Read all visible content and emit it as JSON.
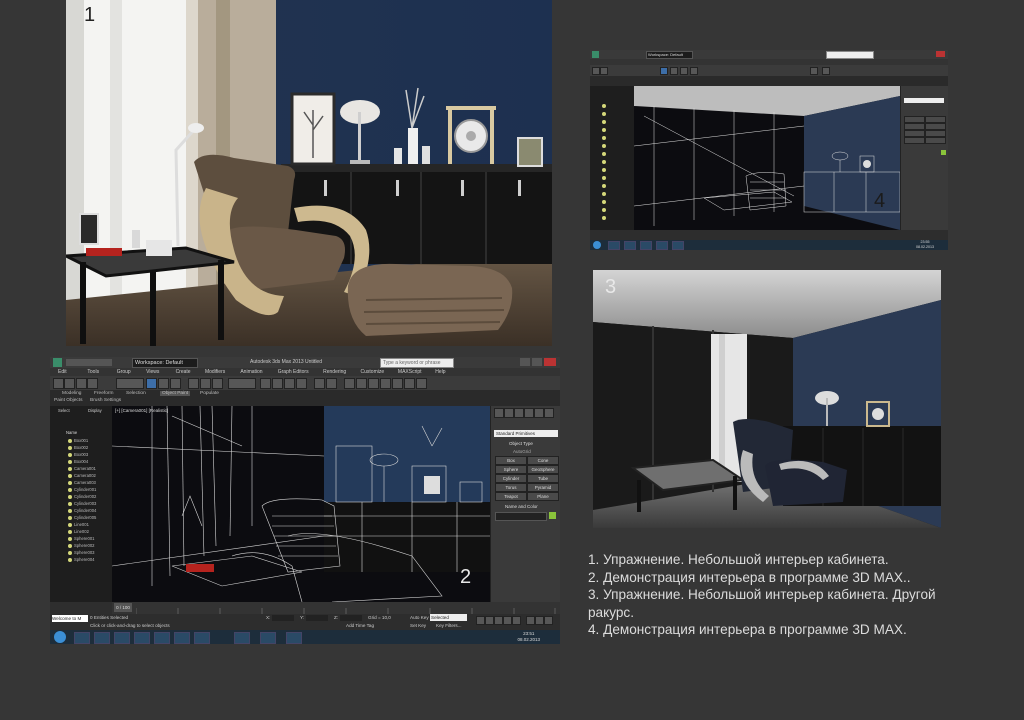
{
  "panels": [
    {
      "number": "1"
    },
    {
      "number": "2"
    },
    {
      "number": "3"
    },
    {
      "number": "4"
    }
  ],
  "max_ui_large": {
    "workspace": "Workspace: Default",
    "title": "Autodesk 3ds Max 2013 Untitled",
    "search_placeholder": "Type a keyword or phrase",
    "menu": [
      "Edit",
      "Tools",
      "Group",
      "Views",
      "Create",
      "Modifiers",
      "Animation",
      "Graph Editors",
      "Rendering",
      "Customize",
      "MAXScript",
      "Help"
    ],
    "ribbon_tabs": [
      "Modeling",
      "Freeform",
      "Selection",
      "Object Paint",
      "Populate"
    ],
    "ribbon_sub": [
      "Paint Objects",
      "Brush Settings"
    ],
    "scene_tabs": [
      "Select",
      "Display"
    ],
    "scene_header": "Name",
    "scene_items": [
      "Box001",
      "Box002",
      "Box003",
      "Box004",
      "Camera001",
      "Camera002",
      "Camera003",
      "Cylinder001",
      "Cylinder002",
      "Cylinder003",
      "Cylinder004",
      "Cylinder005",
      "Line001",
      "Line002",
      "Sphere001",
      "Sphere002",
      "Sphere003",
      "Sphere004"
    ],
    "viewport_label": "[+] [Camera001] [Realistic]",
    "cmd_dropdown": "Standard Primitives",
    "object_type_header": "Object Type",
    "autogrid": "AutoGrid",
    "object_buttons": [
      "Box",
      "Cone",
      "Sphere",
      "GeoSphere",
      "Cylinder",
      "Tube",
      "Torus",
      "Pyramid",
      "Teapot",
      "Plane"
    ],
    "name_color_header": "Name and Color",
    "timeline_frames": "0 / 100",
    "status_selected": "0 Entities Selected",
    "status_prompt": "Click or click-and-drag to select objects",
    "coords": {
      "x": "X:",
      "y": "Y:",
      "z": "Z:"
    },
    "grid": "Grid = 10,0",
    "autokey": "Auto Key",
    "selected_dropdown": "Selected",
    "set_key": "Set Key",
    "key_filters": "Key Filters...",
    "add_time_tag": "Add Time Tag",
    "welcome": "Welcome to M",
    "clock_time": "23:51",
    "clock_date": "08.02.2013"
  },
  "max_ui_small": {
    "workspace": "Workspace: Default",
    "clock_time": "23:55",
    "clock_date": "08.02.2013"
  },
  "caption": [
    "1. Упражнение. Небольшой интерьер кабинета.",
    "2. Демонстрация интерьера в программе 3D MAX..",
    "3. Упражнение. Небольшой интерьер кабинета. Другой",
    "ракурс.",
    "4. Демонстрация интерьера в программе 3D MAX."
  ],
  "colors": {
    "background": "#363636",
    "max_ui": "#2e2e2e",
    "accent_blue": "#3d6ea8",
    "wall_blue": "#1a2b4a",
    "caption": "#dcdcdc"
  }
}
